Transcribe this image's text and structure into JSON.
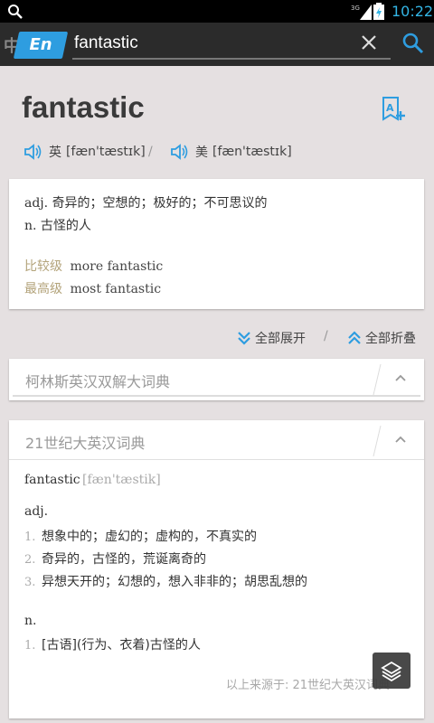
{
  "status_bar": {
    "network": "3G",
    "time": "10:22"
  },
  "search_bar": {
    "lang_from": "中",
    "lang_to": "En",
    "query": "fantastic"
  },
  "word": {
    "headword": "fantastic",
    "pron_uk_label": "英",
    "pron_uk": "[fæn'tæstɪk]",
    "pron_separator": "/",
    "pron_us_label": "美",
    "pron_us": "[fæn'tæstɪk]"
  },
  "basic": {
    "definitions": [
      {
        "pos": "adj.",
        "text": "奇异的；空想的；极好的；不可思议的"
      },
      {
        "pos": "n.",
        "text": "古怪的人"
      }
    ],
    "forms": [
      {
        "label": "比较级",
        "value": "more fantastic"
      },
      {
        "label": "最高级",
        "value": "most fantastic"
      }
    ]
  },
  "toggles": {
    "expand_all": "全部展开",
    "separator": "/",
    "collapse_all": "全部折叠"
  },
  "dictionaries": {
    "collins": {
      "title": "柯林斯英汉双解大词典"
    },
    "century21": {
      "title": "21世纪大英汉词典",
      "headword": "fantastic",
      "phonetic": "[fæn'tæstik]",
      "adj_label": "adj.",
      "adj_senses": [
        {
          "num": "1.",
          "text": "想象中的；虚幻的；虚构的，不真实的"
        },
        {
          "num": "2.",
          "text": "奇异的，古怪的，荒诞离奇的"
        },
        {
          "num": "3.",
          "text": "异想天开的；幻想的，想入非非的；胡思乱想的"
        }
      ],
      "n_label": "n.",
      "n_senses": [
        {
          "num": "1.",
          "text": "[古语](行为、衣着)古怪的人"
        }
      ],
      "source": "以上来源于: 21世纪大英汉词典"
    }
  },
  "colors": {
    "accent": "#2e9de0",
    "status_time": "#33b5e5",
    "form_label": "#b3a37a",
    "background": "#e5e0e1"
  },
  "icons": {
    "status_search": "search-icon",
    "signal": "signal-icon",
    "battery": "battery-icon",
    "clear": "close-icon",
    "search": "search-icon",
    "add_vocab": "add-to-wordbook-icon",
    "speaker": "speaker-icon",
    "expand": "double-chevron-down-icon",
    "collapse": "double-chevron-up-icon",
    "chevron_up": "chevron-up-icon",
    "layers": "layers-icon"
  }
}
